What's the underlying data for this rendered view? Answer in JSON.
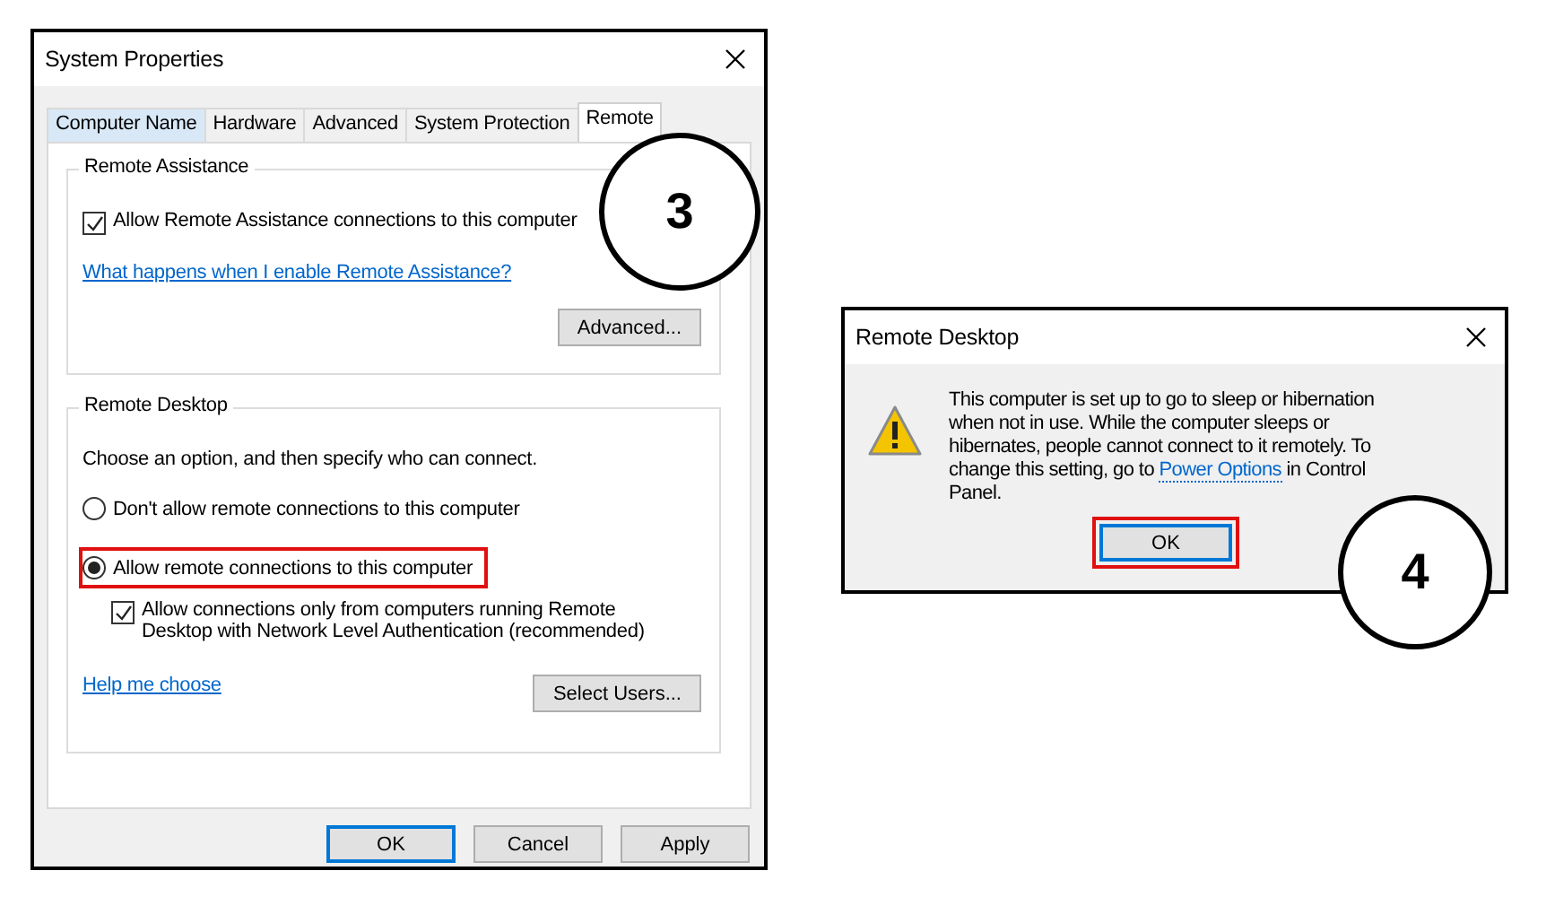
{
  "system_properties": {
    "title": "System Properties",
    "tabs": [
      {
        "label": "Computer Name",
        "selected": false
      },
      {
        "label": "Hardware",
        "selected": false
      },
      {
        "label": "Advanced",
        "selected": false
      },
      {
        "label": "System Protection",
        "selected": false
      },
      {
        "label": "Remote",
        "selected": true
      }
    ],
    "remote_assistance": {
      "legend": "Remote Assistance",
      "checkbox": {
        "label": "Allow Remote Assistance connections to this computer",
        "checked": true
      },
      "link": "What happens when I enable Remote Assistance?",
      "button": "Advanced..."
    },
    "remote_desktop": {
      "legend": "Remote Desktop",
      "instruction": "Choose an option, and then specify who can connect.",
      "options": [
        {
          "label": "Don't allow remote connections to this computer",
          "selected": false,
          "highlighted": false
        },
        {
          "label": "Allow remote connections to this computer",
          "selected": true,
          "highlighted": true
        }
      ],
      "nla_checkbox": {
        "label": "Allow connections only from computers running Remote Desktop with Network Level Authentication (recommended)",
        "checked": true
      },
      "help_link": "Help me choose",
      "button": "Select Users..."
    },
    "buttons": [
      {
        "label": "OK",
        "default": true
      },
      {
        "label": "Cancel",
        "default": false
      },
      {
        "label": "Apply",
        "default": false
      }
    ]
  },
  "remote_desktop_dialog": {
    "title": "Remote Desktop",
    "message_before": "This computer is set up to go to sleep or hibernation when not in use. While the computer sleeps or hibernates, people cannot connect to it remotely. To change this setting, go to",
    "message_link": "Power Options",
    "message_after": "in Control Panel.",
    "button": {
      "label": "OK",
      "default": true,
      "highlighted": true
    }
  },
  "callouts": [
    {
      "number": "3"
    },
    {
      "number": "4"
    }
  ]
}
